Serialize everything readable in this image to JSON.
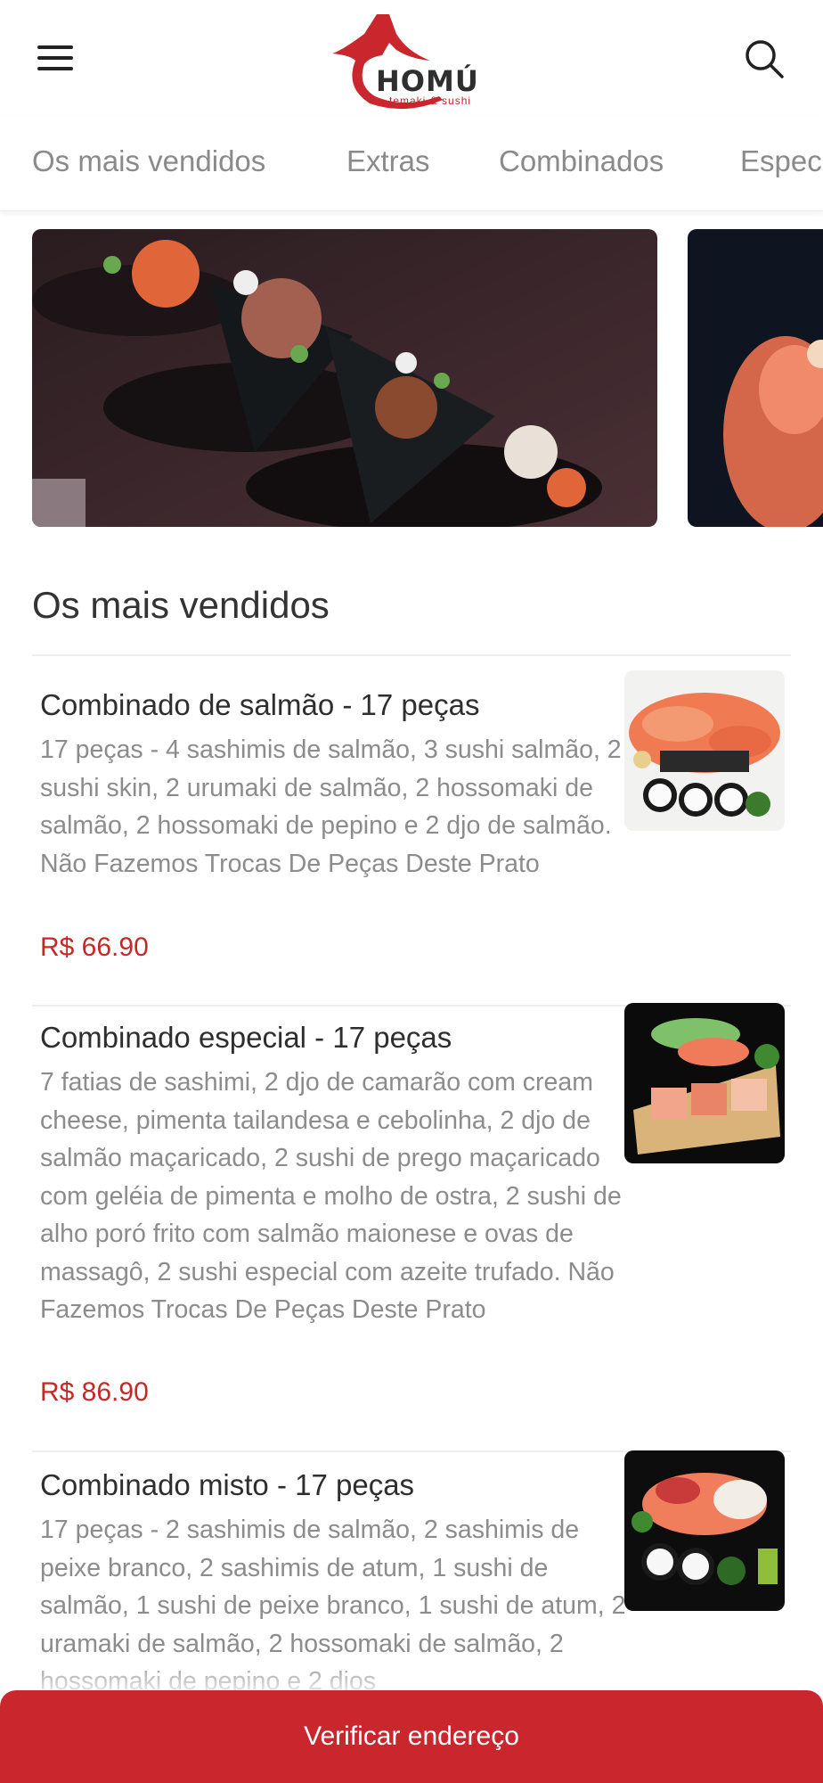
{
  "header": {
    "brand": "HOMÚ",
    "tagline": "temaki & sushi",
    "accent_color": "#c9262e",
    "menu_icon": "hamburger-menu-icon",
    "search_icon": "search-icon"
  },
  "tabs": [
    {
      "label": "Os mais vendidos"
    },
    {
      "label": "Extras"
    },
    {
      "label": "Combinados"
    },
    {
      "label": "Espec"
    }
  ],
  "section": {
    "title": "Os mais vendidos"
  },
  "items": [
    {
      "title": "Combinado de salmão - 17 peças",
      "description": "17 peças - 4 sashimis de salmão, 3 sushi salmão, 2 sushi skin, 2 urumaki de salmão, 2 hossomaki de salmão, 2 hossomaki de pepino e 2 djo de salmão. Não Fazemos Trocas De Peças Deste Prato",
      "price": "R$ 66.90"
    },
    {
      "title": "Combinado especial - 17 peças",
      "description": "7 fatias de sashimi, 2 djo de camarão com cream cheese, pimenta tailandesa e cebolinha, 2 djo de salmão maçaricado, 2 sushi de prego maçaricado com geléia de pimenta e molho de ostra, 2 sushi de alho poró frito com salmão maionese e ovas de massagô, 2 sushi especial com azeite trufado. Não Fazemos Trocas De Peças Deste Prato",
      "price": "R$ 86.90"
    },
    {
      "title": "Combinado misto - 17 peças",
      "description": "17 peças - 2 sashimis de salmão, 2 sashimis de peixe branco, 2 sashimis de atum, 1 sushi de salmão, 1 sushi de peixe branco, 1 sushi de atum, 2 uramaki de salmão, 2 hossomaki de salmão, 2 hossomaki de pepino e 2 djos"
    }
  ],
  "cta": {
    "label": "Verificar endereço"
  }
}
